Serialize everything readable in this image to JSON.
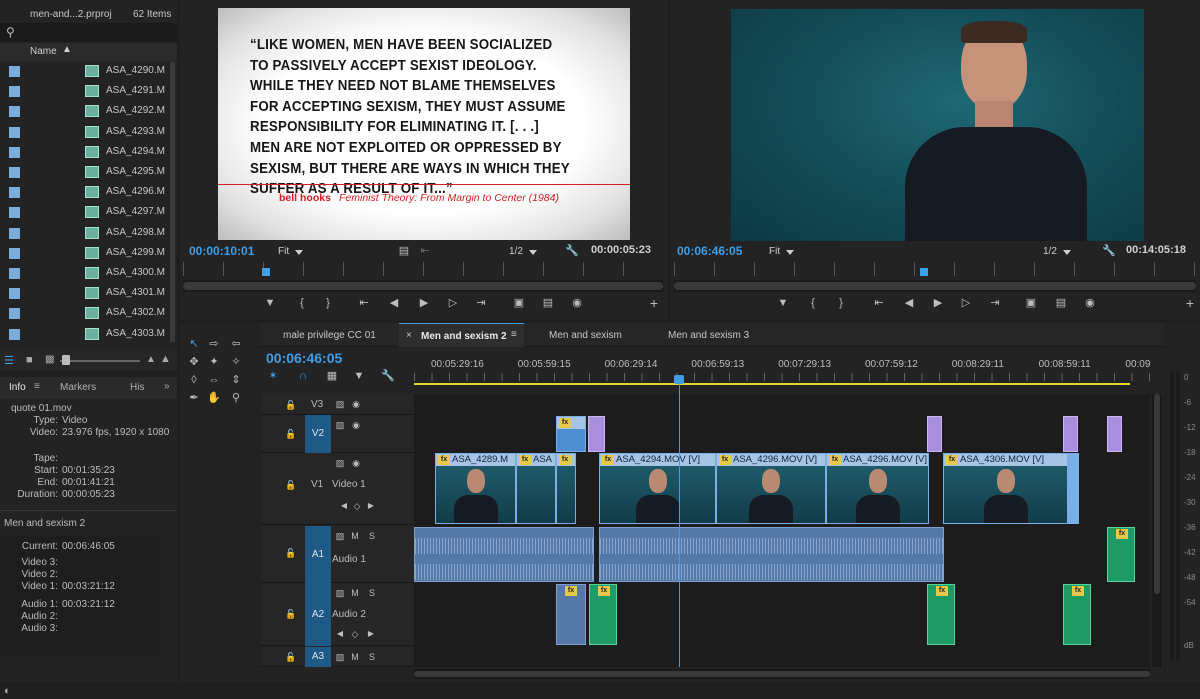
{
  "project": {
    "title": "men-and...2.prproj",
    "count": "62 Items",
    "col_name": "Name",
    "items": [
      "ASA_4290.M",
      "ASA_4291.M",
      "ASA_4292.M",
      "ASA_4293.M",
      "ASA_4294.M",
      "ASA_4295.M",
      "ASA_4296.M",
      "ASA_4297.M",
      "ASA_4298.M",
      "ASA_4299.M",
      "ASA_4300.M",
      "ASA_4301.M",
      "ASA_4302.M",
      "ASA_4303.M"
    ]
  },
  "info": {
    "tabs": [
      "Info",
      "Markers",
      "His"
    ],
    "clip_name": "quote 01.mov",
    "type_label": "Type:",
    "type_value": "Video",
    "video_label": "Video:",
    "video_value": "23.976 fps, 1920 x 1080",
    "tape_label": "Tape:",
    "start_label": "Start:",
    "start_value": "00:01:35:23",
    "end_label": "End:",
    "end_value": "00:01:41:21",
    "duration_label": "Duration:",
    "duration_value": "00:00:05:23",
    "seq_name": "Men and sexism 2",
    "current_label": "Current:",
    "current_value": "00:06:46:05",
    "video3": "Video 3:",
    "video2": "Video 2:",
    "video1": "Video 1:",
    "video1_value": "00:03:21:12",
    "audio1": "Audio 1:",
    "audio1_value": "00:03:21:12",
    "audio2": "Audio 2:",
    "audio3": "Audio 3:"
  },
  "source": {
    "quote": "“LIKE WOMEN, MEN HAVE BEEN SOCIALIZED TO PASSIVELY ACCEPT SEXIST IDEOLOGY. WHILE THEY NEED NOT BLAME THEMSELVES FOR ACCEPTING SEXISM, THEY MUST ASSUME RESPONSIBILITY FOR ELIMINATING IT. [. . .] MEN ARE NOT EXPLOITED OR OPPRESSED BY SEXISM, BUT THERE ARE WAYS IN WHICH THEY SUFFER AS A RESULT OF IT...”",
    "author": "bell hooks",
    "work": "Feminist Theory: From Margin to Center (1984)",
    "timecode": "00:00:10:01",
    "fit": "Fit",
    "res": "1/2",
    "duration": "00:00:05:23"
  },
  "program": {
    "timecode": "00:06:46:05",
    "fit": "Fit",
    "res": "1/2",
    "duration": "00:14:05:18"
  },
  "timeline": {
    "tabs": [
      "male privilege CC 01",
      "Men and sexism 2",
      "Men and sexism",
      "Men and sexism 3"
    ],
    "active_tab": "Men and sexism 2",
    "timecode": "00:06:46:05",
    "ruler": [
      "00:05:29:16",
      "00:05:59:15",
      "00:06:29:14",
      "00:06:59:13",
      "00:07:29:13",
      "00:07:59:12",
      "00:08:29:11",
      "00:08:59:11",
      "00:09"
    ],
    "tracks": {
      "v3": "V3",
      "v2": "V2",
      "v1": "V1",
      "v1_name": "Video 1",
      "a1": "A1",
      "a1_name": "Audio 1",
      "a2": "A2",
      "a2_name": "Audio 2",
      "a3": "A3"
    },
    "clips": [
      "ASA_4289.M",
      "ASA",
      "ASA_4294.MOV [V]",
      "ASA_4296.MOV [V]",
      "ASA_4296.MOV [V]",
      "ASA_4306.MOV [V]"
    ]
  },
  "meter": {
    "labels": [
      "0",
      "-6",
      "-12",
      "-18",
      "-24",
      "-30",
      "-36",
      "-42",
      "-48",
      "-54",
      "dB"
    ]
  },
  "colors": {
    "accent": "#3f9ee8",
    "video_clip": "#4d8fd0",
    "audio_clip": "#5478a8",
    "green_clip": "#1e9a66",
    "purple_clip": "#a98ee0",
    "quote_red": "#d32020"
  }
}
